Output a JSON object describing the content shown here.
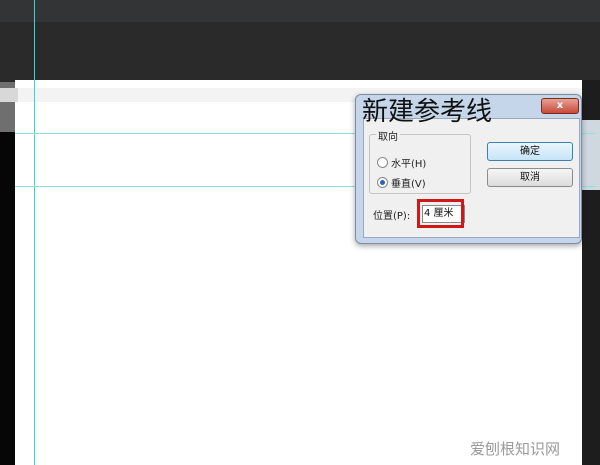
{
  "dialog": {
    "title": "新建参考线",
    "close_label": "x",
    "orientation_group": "取向",
    "horizontal_label": "水平(H)",
    "vertical_label": "垂直(V)",
    "selected_orientation": "vertical",
    "ok_label": "确定",
    "cancel_label": "取消",
    "position_label": "位置(P):",
    "position_value": "4 厘米"
  },
  "watermark": "爱刨根知识网",
  "colors": {
    "guide": "#39d4d4",
    "highlight": "#d01818",
    "dialog_frame": "#c6d6ea"
  }
}
